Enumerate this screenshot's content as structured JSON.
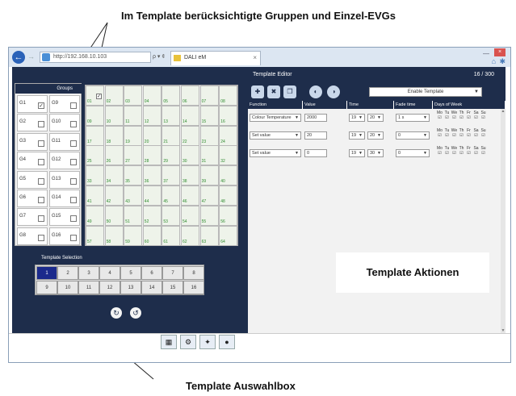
{
  "callouts": {
    "top": "Im Template berücksichtigte Gruppen und Einzel-EVGs",
    "middle": "Template Aktionen",
    "bottom": "Template Auswahlbox"
  },
  "browser": {
    "address": "http://192.168.10.103",
    "address_controls": "ρ ▾ ¢",
    "tab_title": "DALI eM",
    "tab_close": "×",
    "minimize": "—",
    "close": "×",
    "home": "⌂",
    "gear": "✱",
    "back": "←",
    "forward": "→"
  },
  "groups": {
    "title": "Groups",
    "items": [
      {
        "label": "G1",
        "checked": true
      },
      {
        "label": "G9",
        "checked": false
      },
      {
        "label": "G2",
        "checked": false
      },
      {
        "label": "G10",
        "checked": false
      },
      {
        "label": "G3",
        "checked": false
      },
      {
        "label": "G11",
        "checked": false
      },
      {
        "label": "G4",
        "checked": false
      },
      {
        "label": "G12",
        "checked": false
      },
      {
        "label": "G5",
        "checked": false
      },
      {
        "label": "G13",
        "checked": false
      },
      {
        "label": "G6",
        "checked": false
      },
      {
        "label": "G14",
        "checked": false
      },
      {
        "label": "G7",
        "checked": false
      },
      {
        "label": "G15",
        "checked": false
      },
      {
        "label": "G8",
        "checked": false
      },
      {
        "label": "G16",
        "checked": false
      }
    ]
  },
  "evgs": {
    "cells": [
      "01",
      "02",
      "03",
      "04",
      "05",
      "06",
      "07",
      "08",
      "09",
      "10",
      "11",
      "12",
      "13",
      "14",
      "15",
      "16",
      "17",
      "18",
      "19",
      "20",
      "21",
      "22",
      "23",
      "24",
      "25",
      "26",
      "27",
      "28",
      "29",
      "30",
      "31",
      "32",
      "33",
      "34",
      "35",
      "36",
      "37",
      "38",
      "39",
      "40",
      "41",
      "42",
      "43",
      "44",
      "45",
      "46",
      "47",
      "48",
      "49",
      "50",
      "51",
      "52",
      "53",
      "54",
      "55",
      "56",
      "57",
      "58",
      "59",
      "60",
      "61",
      "62",
      "63",
      "64"
    ],
    "checked_first": "✓"
  },
  "template_selection": {
    "title": "Template Selection",
    "numbers": [
      "1",
      "2",
      "3",
      "4",
      "5",
      "6",
      "7",
      "8",
      "9",
      "10",
      "11",
      "12",
      "13",
      "14",
      "15",
      "16"
    ],
    "selected": "1"
  },
  "editor": {
    "title": "Template Editor",
    "counter": "16 / 300",
    "mode": "Enable Template",
    "columns": [
      "Function",
      "Value",
      "Time",
      "Fade time",
      "Days of Week"
    ],
    "days": [
      "Mo",
      "Tu",
      "We",
      "Th",
      "Fr",
      "Sa",
      "Su"
    ],
    "rows": [
      {
        "function": "Colour Temperature",
        "value": "2000",
        "hour": "19",
        "minute": "20",
        "fade": "1 s"
      },
      {
        "function": "Set value",
        "value": "20",
        "hour": "19",
        "minute": "20",
        "fade": "0"
      },
      {
        "function": "Set value",
        "value": "0",
        "hour": "19",
        "minute": "30",
        "fade": "0"
      }
    ]
  }
}
